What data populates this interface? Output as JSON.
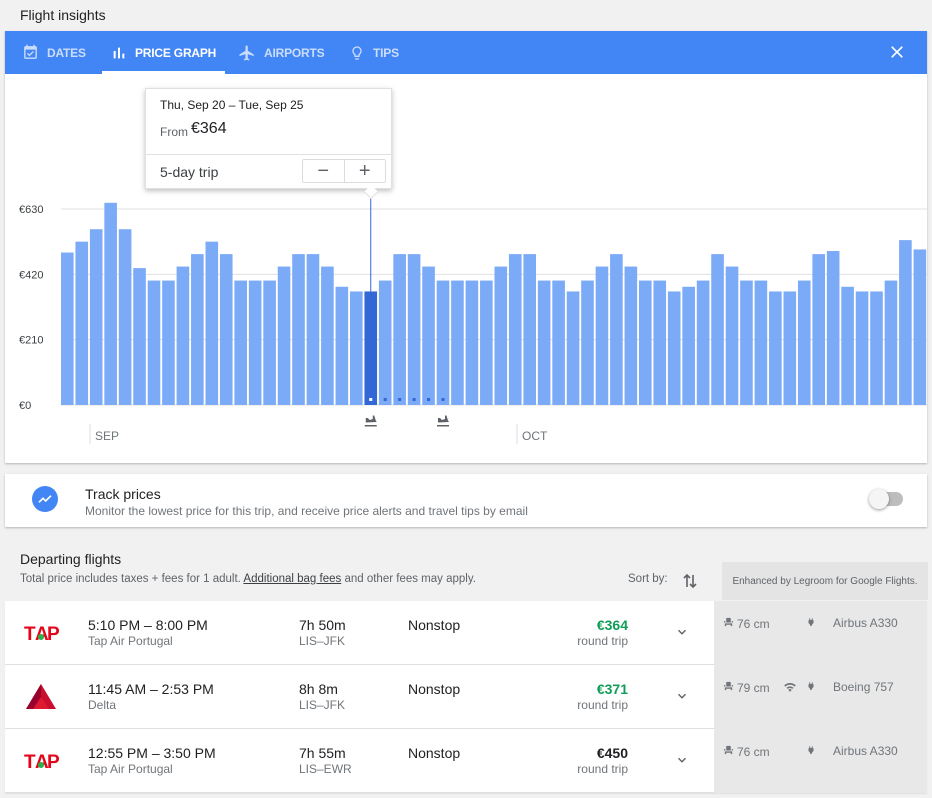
{
  "page": {
    "title": "Flight insights"
  },
  "tabs": [
    {
      "label": "DATES",
      "icon": "calendar-icon",
      "active": false
    },
    {
      "label": "PRICE GRAPH",
      "icon": "bar-chart-icon",
      "active": true
    },
    {
      "label": "AIRPORTS",
      "icon": "airplane-icon",
      "active": false
    },
    {
      "label": "TIPS",
      "icon": "lightbulb-icon",
      "active": false
    }
  ],
  "colors": {
    "primary": "#4285f4",
    "bar": "#7baaf7",
    "bar_selected": "#3367d6",
    "deal_price": "#0f9d58"
  },
  "popup": {
    "dates": "Thu, Sep 20 – Tue, Sep 25",
    "from_label": "From",
    "from_price": "€364",
    "trip_length": "5-day trip",
    "minus": "−",
    "plus": "+"
  },
  "chart_data": {
    "type": "bar",
    "y_ticks": [
      "€630",
      "€420",
      "€210",
      "€0"
    ],
    "ylim": [
      0,
      630
    ],
    "month_labels": [
      "SEP",
      "OCT"
    ],
    "selected_index": 21,
    "return_index": 26,
    "values": [
      490,
      525,
      565,
      650,
      565,
      440,
      400,
      400,
      445,
      485,
      525,
      485,
      400,
      400,
      400,
      445,
      485,
      485,
      445,
      380,
      365,
      365,
      400,
      485,
      485,
      445,
      400,
      400,
      400,
      400,
      445,
      485,
      485,
      400,
      400,
      365,
      400,
      445,
      485,
      445,
      400,
      400,
      365,
      380,
      400,
      485,
      445,
      400,
      400,
      365,
      365,
      400,
      485,
      495,
      380,
      365,
      365,
      400,
      530,
      500,
      440
    ]
  },
  "track": {
    "title": "Track prices",
    "subtitle": "Monitor the lowest price for this trip, and receive price alerts and travel tips by email",
    "enabled": false
  },
  "departing": {
    "title": "Departing flights",
    "subtitle_prefix": "Total price includes taxes + fees for 1 adult.",
    "bag_fees_link": "Additional bag fees",
    "subtitle_suffix": "and other fees may apply.",
    "sort_label": "Sort by:",
    "legroom_note": "Enhanced by Legroom for Google Flights."
  },
  "flights": [
    {
      "times": "5:10 PM – 8:00 PM",
      "airline": "Tap Air Portugal",
      "logo": "tap-logo",
      "duration": "7h 50m",
      "route": "LIS–JFK",
      "stops": "Nonstop",
      "price": "€364",
      "deal": true,
      "trip_type": "round trip",
      "legroom": "76 cm",
      "wifi": false,
      "aircraft": "Airbus A330"
    },
    {
      "times": "11:45 AM – 2:53 PM",
      "airline": "Delta",
      "logo": "delta-logo",
      "duration": "8h 8m",
      "route": "LIS–JFK",
      "stops": "Nonstop",
      "price": "€371",
      "deal": true,
      "trip_type": "round trip",
      "legroom": "79 cm",
      "wifi": true,
      "aircraft": "Boeing 757"
    },
    {
      "times": "12:55 PM – 3:50 PM",
      "airline": "Tap Air Portugal",
      "logo": "tap-logo",
      "duration": "7h 55m",
      "route": "LIS–EWR",
      "stops": "Nonstop",
      "price": "€450",
      "deal": false,
      "trip_type": "round trip",
      "legroom": "76 cm",
      "wifi": false,
      "aircraft": "Airbus A330"
    }
  ]
}
